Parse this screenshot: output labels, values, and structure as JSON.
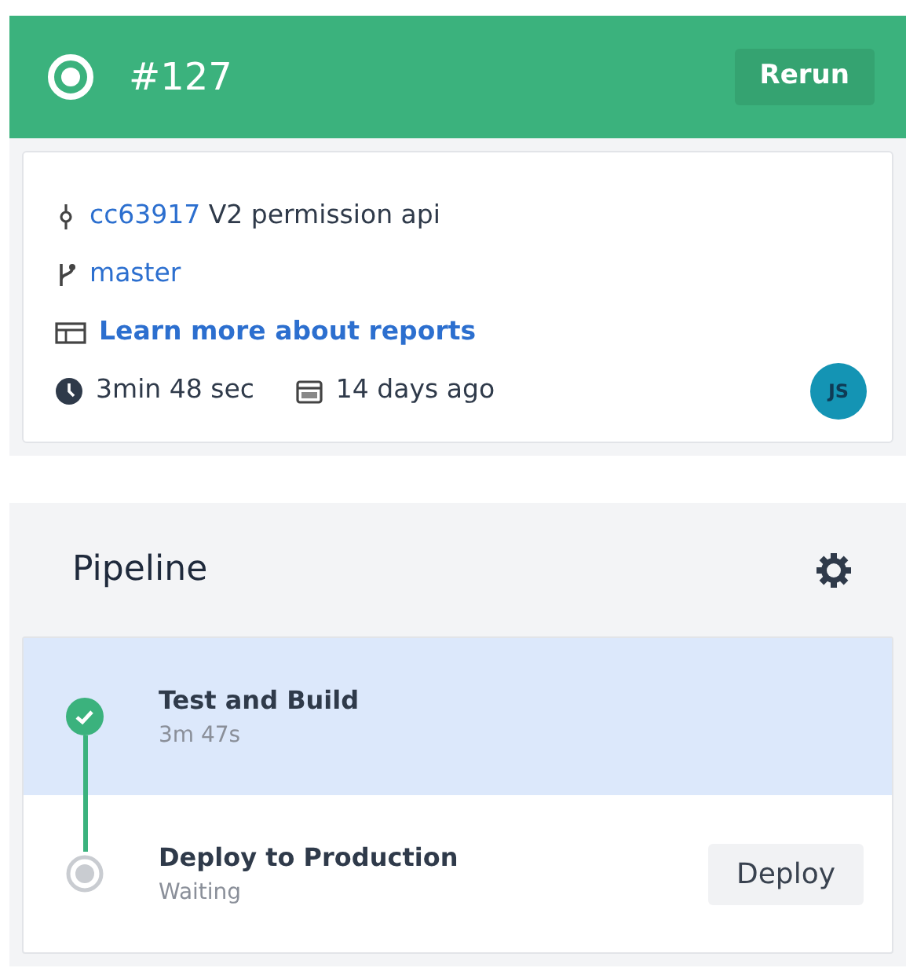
{
  "build": {
    "number": "#127",
    "rerun_label": "Rerun"
  },
  "info": {
    "commit_hash": "cc63917",
    "commit_message": "V2 permission api",
    "branch": "master",
    "reports_link": "Learn more about reports",
    "duration": "3min 48 sec",
    "age": "14 days ago",
    "avatar": "JS"
  },
  "pipeline": {
    "title": "Pipeline",
    "steps": [
      {
        "name": "Test and Build",
        "detail": "3m 47s",
        "kind": "done",
        "selected": true
      },
      {
        "name": "Deploy to Production",
        "detail": "Waiting",
        "kind": "waiting",
        "selected": false,
        "action": "Deploy"
      }
    ]
  }
}
